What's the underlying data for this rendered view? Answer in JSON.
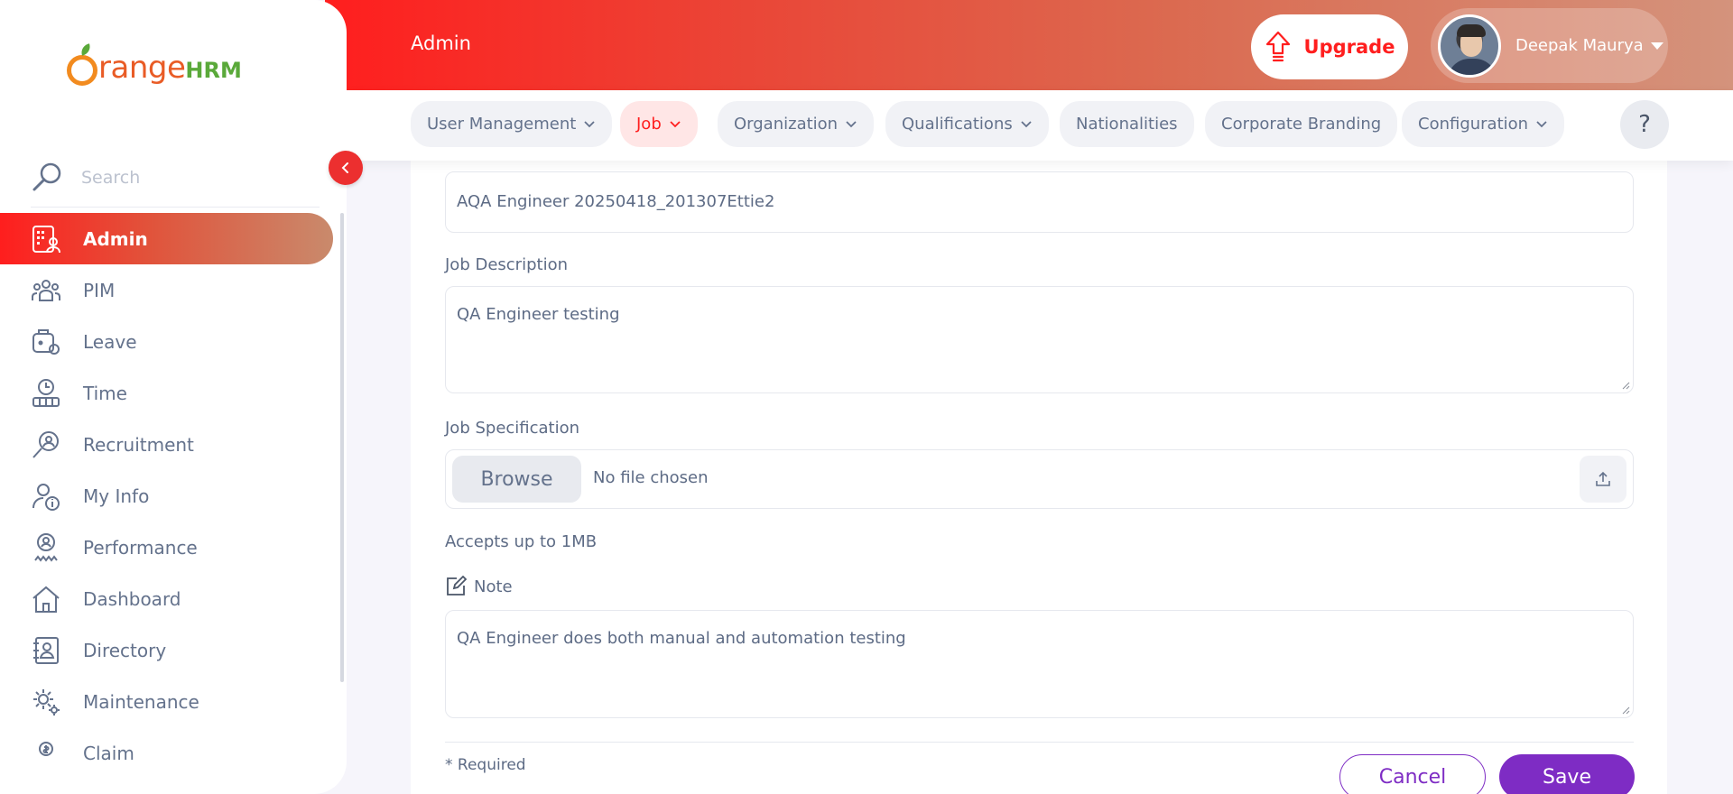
{
  "brand": {
    "text_main": "range",
    "text_hrm": "HRM"
  },
  "search": {
    "placeholder": "Search"
  },
  "sidebar": {
    "items": [
      {
        "label": "Admin",
        "icon": "admin-icon",
        "active": true
      },
      {
        "label": "PIM",
        "icon": "pim-icon"
      },
      {
        "label": "Leave",
        "icon": "leave-icon"
      },
      {
        "label": "Time",
        "icon": "time-icon"
      },
      {
        "label": "Recruitment",
        "icon": "recruitment-icon"
      },
      {
        "label": "My Info",
        "icon": "my-info-icon"
      },
      {
        "label": "Performance",
        "icon": "performance-icon"
      },
      {
        "label": "Dashboard",
        "icon": "dashboard-icon"
      },
      {
        "label": "Directory",
        "icon": "directory-icon"
      },
      {
        "label": "Maintenance",
        "icon": "maintenance-icon"
      },
      {
        "label": "Claim",
        "icon": "claim-icon"
      }
    ]
  },
  "header": {
    "title": "Admin",
    "upgrade_label": "Upgrade",
    "user_name": "Deepak Maurya"
  },
  "topnav": {
    "tabs": [
      {
        "label": "User Management",
        "dropdown": true
      },
      {
        "label": "Job",
        "dropdown": true,
        "active": true
      },
      {
        "label": "Organization",
        "dropdown": true
      },
      {
        "label": "Qualifications",
        "dropdown": true
      },
      {
        "label": "Nationalities",
        "dropdown": false
      },
      {
        "label": "Corporate Branding",
        "dropdown": false
      },
      {
        "label": "Configuration",
        "dropdown": true
      }
    ],
    "help_label": "?"
  },
  "form": {
    "job_title_value": "AQA Engineer 20250418_201307Ettie2",
    "job_description_label": "Job Description",
    "job_description_value": "QA Engineer testing",
    "job_specification_label": "Job Specification",
    "browse_label": "Browse",
    "file_status": "No file chosen",
    "accepts_hint": "Accepts up to 1MB",
    "note_label": "Note",
    "note_value": "QA Engineer does both manual and automation testing",
    "required_hint": "* Required",
    "cancel_label": "Cancel",
    "save_label": "Save"
  },
  "colors": {
    "brand_red": "#ff1e1e",
    "accent_purple": "#7e2cc4",
    "text_gray": "#64728c"
  }
}
